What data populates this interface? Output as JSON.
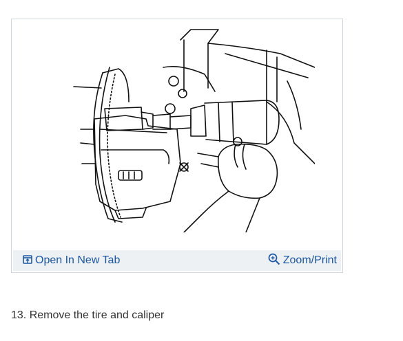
{
  "figure": {
    "open_tab_label": "Open In New Tab",
    "zoom_label": "Zoom/Print",
    "open_icon": "open-in-new-tab-icon",
    "zoom_icon": "magnifier-icon",
    "link_color": "#1b57a6",
    "toolbar_color": "#edf1f4"
  },
  "step": {
    "text": "13. Remove the tire and caliper"
  }
}
